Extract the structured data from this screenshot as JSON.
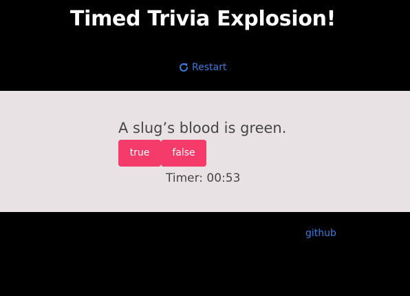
{
  "header": {
    "title": "Timed Trivia Explosion!",
    "restart_label": "Restart"
  },
  "quiz": {
    "question": "A slug’s blood is green.",
    "answers": {
      "true_label": "true",
      "false_label": "false"
    },
    "timer_text": "Timer: 00:53"
  },
  "footer": {
    "github_label": "github"
  },
  "colors": {
    "background": "#000000",
    "panel": "#e8e2e4",
    "accent_button": "#f43b6a",
    "link": "#3b7de0",
    "title_text": "#ffffff",
    "body_text": "#454545"
  },
  "icons": {
    "restart": "redo-arrow-icon"
  }
}
